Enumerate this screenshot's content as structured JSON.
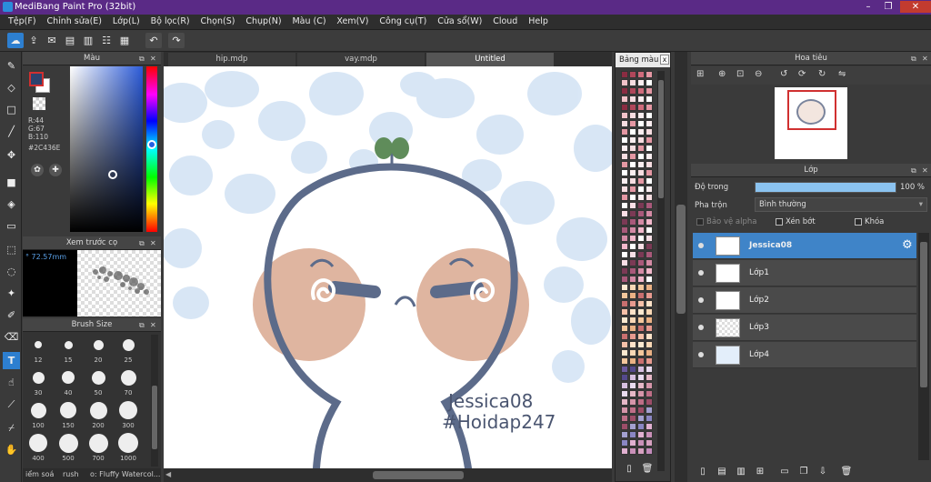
{
  "window": {
    "title": "MediBang Paint Pro (32bit)",
    "min": "–",
    "max": "❐",
    "close": "✕"
  },
  "menu": [
    "Tệp(F)",
    "Chỉnh sửa(E)",
    "Lớp(L)",
    "Bộ lọc(R)",
    "Chọn(S)",
    "Chụp(N)",
    "Màu (C)",
    "Xem(V)",
    "Công cụ(T)",
    "Cửa sổ(W)",
    "Cloud",
    "Help"
  ],
  "toolbar": {
    "undo": "↶",
    "redo": "↷"
  },
  "color_panel": {
    "title": "Màu",
    "r": "R:44",
    "g": "G:67",
    "b": "B:110",
    "hex": "#2C436E",
    "current_color": "#2C436E"
  },
  "preview_panel": {
    "title": "Xem trước cọ",
    "size": "° 72.57mm"
  },
  "brush_panel": {
    "title": "Brush Size",
    "sizes": [
      "12",
      "15",
      "20",
      "25",
      "30",
      "40",
      "50",
      "70",
      "100",
      "150",
      "200",
      "300",
      "400",
      "500",
      "700",
      "1000"
    ]
  },
  "status": {
    "item1": "iểm soá",
    "item2": "rush",
    "item3": "o: Fluffy Watercol..."
  },
  "tabs": [
    "hip.mdp",
    "vay.mdp",
    "Untitled"
  ],
  "canvas": {
    "text1": "Jessica08",
    "text2": "#Hoidap247"
  },
  "palette": {
    "title": "Bảng màu",
    "close": "x"
  },
  "navigator": {
    "title": "Hoa tiêu"
  },
  "layers": {
    "title": "Lớp",
    "opacity_label": "Độ trong",
    "opacity_value": "100 %",
    "opacity": 1.0,
    "blend_label": "Pha trộn",
    "blend_value": "Bình thường",
    "protect_alpha": "Bảo vệ alpha",
    "clip": "Xén bớt",
    "lock": "Khóa",
    "items": [
      "Jessica08",
      "Lớp1",
      "Lớp2",
      "Lớp3",
      "Lớp4"
    ]
  }
}
